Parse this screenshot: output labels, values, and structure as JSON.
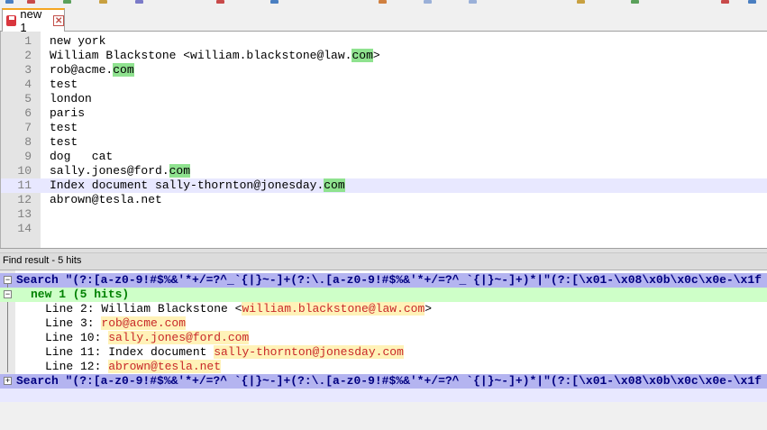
{
  "tab": {
    "label": "new 1"
  },
  "editor": {
    "current_line": 11,
    "lines": [
      {
        "num": "1",
        "parts": [
          {
            "t": "new york"
          }
        ]
      },
      {
        "num": "2",
        "parts": [
          {
            "t": "William Blackstone <william.blackstone@law."
          },
          {
            "t": "com",
            "hl": true
          },
          {
            "t": ">"
          }
        ]
      },
      {
        "num": "3",
        "parts": [
          {
            "t": "rob@acme."
          },
          {
            "t": "com",
            "hl": true
          }
        ]
      },
      {
        "num": "4",
        "parts": [
          {
            "t": "test"
          }
        ]
      },
      {
        "num": "5",
        "parts": [
          {
            "t": "london"
          }
        ]
      },
      {
        "num": "6",
        "parts": [
          {
            "t": "paris"
          }
        ]
      },
      {
        "num": "7",
        "parts": [
          {
            "t": "test"
          }
        ]
      },
      {
        "num": "8",
        "parts": [
          {
            "t": "test"
          }
        ]
      },
      {
        "num": "9",
        "parts": [
          {
            "t": "dog   cat"
          }
        ]
      },
      {
        "num": "10",
        "parts": [
          {
            "t": "sally.jones@ford."
          },
          {
            "t": "com",
            "hl": true
          }
        ]
      },
      {
        "num": "11",
        "parts": [
          {
            "t": "Index document sally-thornton@jonesday."
          },
          {
            "t": "com",
            "hl": true
          }
        ]
      },
      {
        "num": "12",
        "parts": [
          {
            "t": "abrown@tesla.net"
          }
        ]
      },
      {
        "num": "13",
        "parts": [
          {
            "t": ""
          }
        ]
      },
      {
        "num": "14",
        "parts": [
          {
            "t": ""
          }
        ]
      }
    ]
  },
  "find_panel": {
    "title": "Find result - 5 hits",
    "search_text": "Search \"(?:[a-z0-9!#$%&'*+/=?^_`{|}~-]+(?:\\.[a-z0-9!#$%&'*+/=?^_`{|}~-]+)*|\"(?:[\\x01-\\x08\\x0b\\x0c\\x0e-\\x1f",
    "search_text_2": "Search \"(?:[a-z0-9!#$%&'*+/=?^ `{|}~-]+(?:\\.[a-z0-9!#$%&'*+/=?^ `{|}~-]+)*|\"(?:[\\x01-\\x08\\x0b\\x0c\\x0e-\\x1f",
    "file_header": "new 1 (5 hits)",
    "results": [
      {
        "prefix": "Line 2: William Blackstone <",
        "match": "william.blackstone@law.com",
        "suffix": ">"
      },
      {
        "prefix": "Line 3: ",
        "match": "rob@acme.com",
        "suffix": ""
      },
      {
        "prefix": "Line 10: ",
        "match": "sally.jones@ford.com",
        "suffix": ""
      },
      {
        "prefix": "Line 11: Index document ",
        "match": "sally-thornton@jonesday.com",
        "suffix": ""
      },
      {
        "prefix": "Line 12: ",
        "match": "abrown@tesla.net",
        "suffix": ""
      }
    ]
  },
  "colors": {
    "match_highlight": "#8fe28f",
    "current_line": "#e8e8ff",
    "search_row": "#b4b4f0",
    "file_row": "#ceffc8",
    "match_text": "#c82828"
  }
}
